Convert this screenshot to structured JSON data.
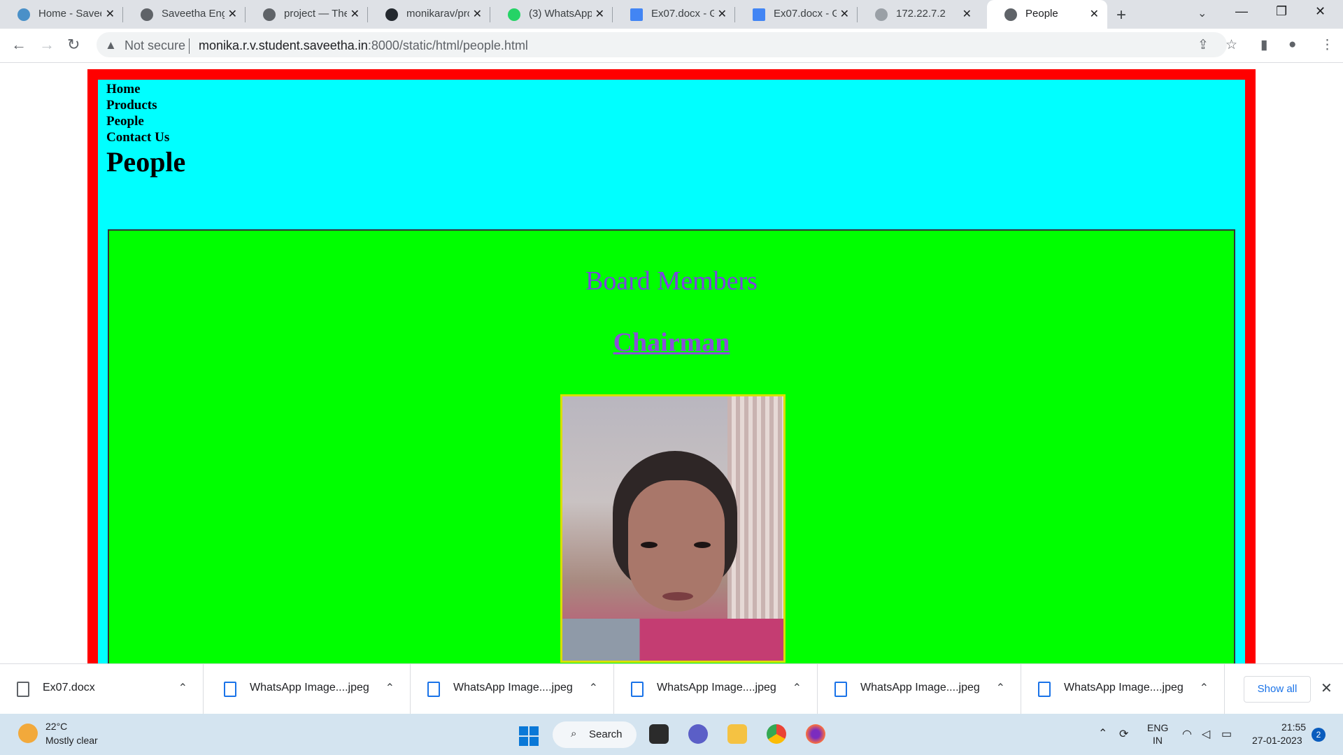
{
  "browser": {
    "tabs": [
      {
        "title": "Home - Saveetha"
      },
      {
        "title": "Saveetha Engineering"
      },
      {
        "title": "project — The"
      },
      {
        "title": "monikarav/project"
      },
      {
        "title": "(3) WhatsApp"
      },
      {
        "title": "Ex07.docx - Google"
      },
      {
        "title": "Ex07.docx - Google"
      },
      {
        "title": "172.22.7.2"
      },
      {
        "title": "People"
      }
    ],
    "new_tab": "+",
    "security_label": "Not secure",
    "url_host": "monika.r.v.student.saveetha.in",
    "url_rest": ":8000/static/html/people.html"
  },
  "page": {
    "menu": {
      "home": "Home",
      "products": "Products",
      "people": "People",
      "contact": "Contact Us"
    },
    "heading": "People",
    "section_title": "Board Members",
    "role_link": "Chairman",
    "colors": {
      "outer_border": "#ff0000",
      "header_bg": "#00ffff",
      "content_bg": "#00ff00",
      "section_title": "#7b43e0",
      "photo_border": "#d7e000"
    }
  },
  "downloads": {
    "items": [
      {
        "name": "Ex07.docx",
        "icon": "document-icon"
      },
      {
        "name": "WhatsApp Image....jpeg",
        "icon": "image-file-icon"
      },
      {
        "name": "WhatsApp Image....jpeg",
        "icon": "image-file-icon"
      },
      {
        "name": "WhatsApp Image....jpeg",
        "icon": "image-file-icon"
      },
      {
        "name": "WhatsApp Image....jpeg",
        "icon": "image-file-icon"
      },
      {
        "name": "WhatsApp Image....jpeg",
        "icon": "image-file-icon"
      }
    ],
    "show_all": "Show all"
  },
  "taskbar": {
    "weather_temp": "22°C",
    "weather_condition": "Mostly clear",
    "search_label": "Search",
    "language_1": "ENG",
    "language_2": "IN",
    "time": "21:55",
    "date": "27-01-2023",
    "notification_count": "2"
  }
}
